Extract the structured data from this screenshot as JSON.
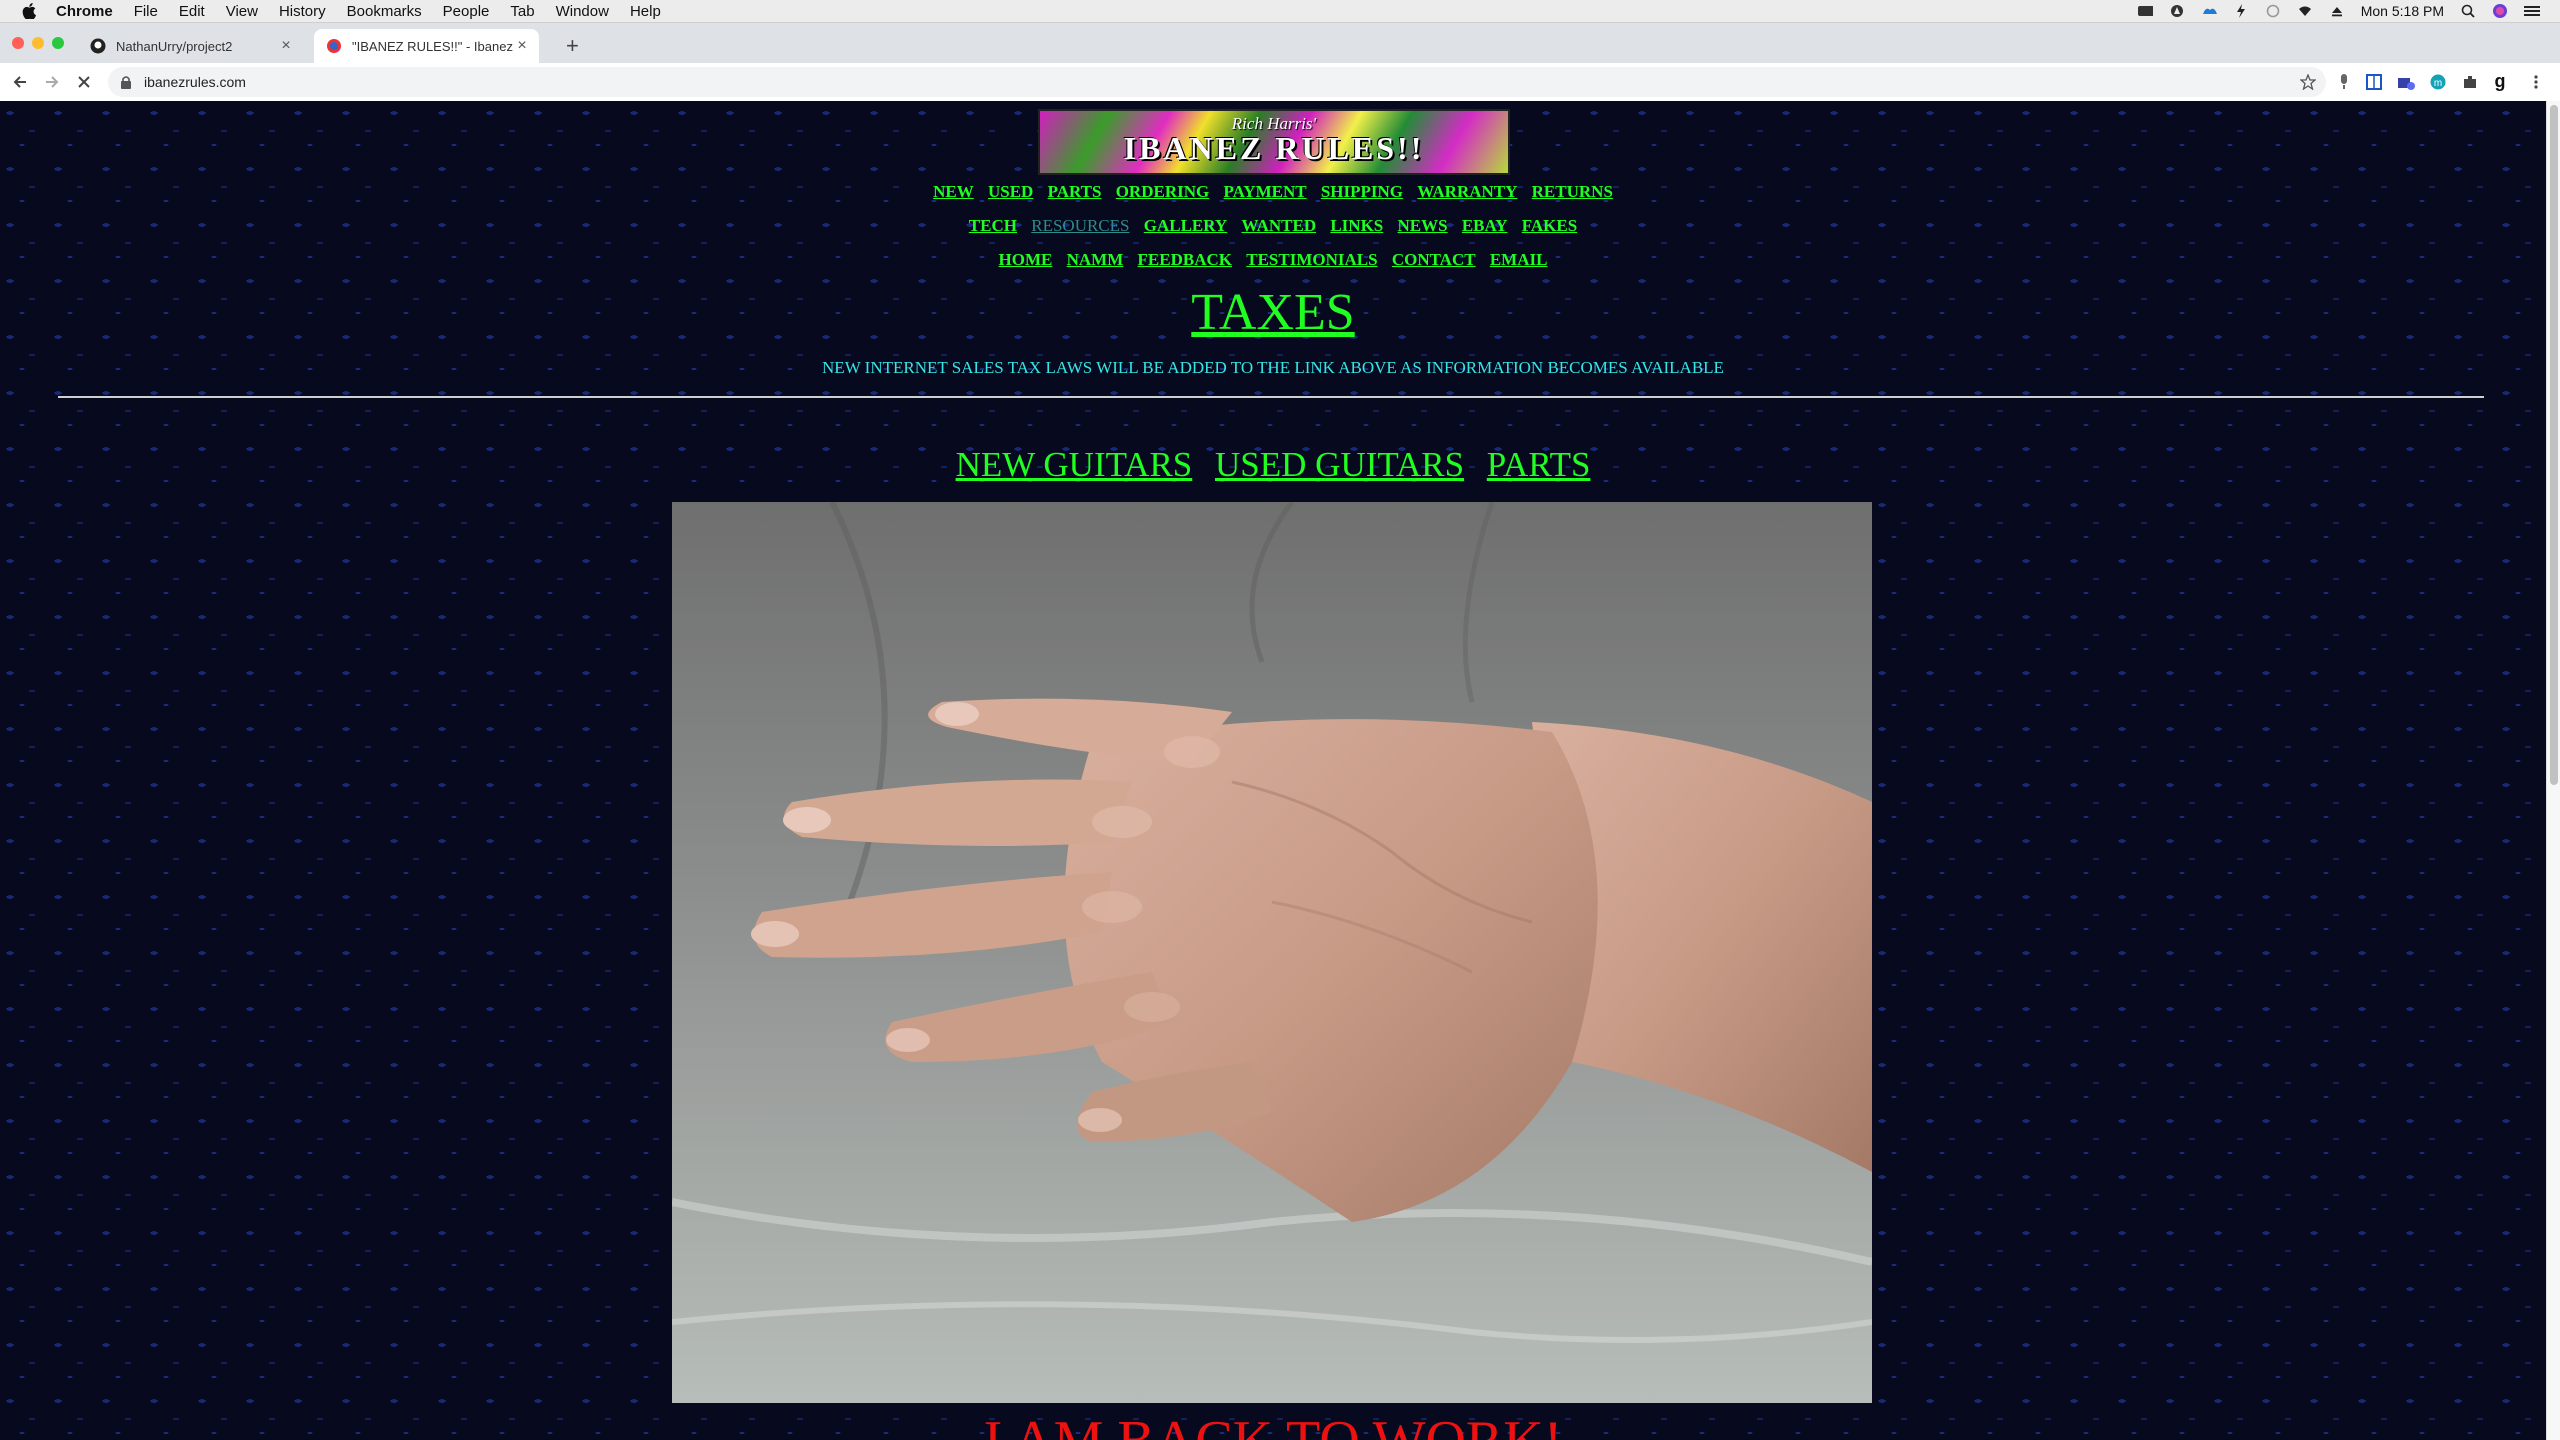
{
  "menubar": {
    "app": "Chrome",
    "items": [
      "File",
      "Edit",
      "View",
      "History",
      "Bookmarks",
      "People",
      "Tab",
      "Window",
      "Help"
    ],
    "clock": "Mon 5:18 PM"
  },
  "tabs": [
    {
      "title": "NathanUrry/project2",
      "icon": "github-icon"
    },
    {
      "title": "\"IBANEZ RULES!!\" - Ibanez Gu",
      "icon": "site-favicon"
    }
  ],
  "address": {
    "url": "ibanezrules.com"
  },
  "page": {
    "banner": {
      "sub": "Rich Harris'",
      "main": "IBANEZ RULES!!"
    },
    "nav_row1": [
      "NEW",
      "USED",
      "PARTS",
      "ORDERING",
      "PAYMENT",
      "SHIPPING",
      "WARRANTY",
      "RETURNS"
    ],
    "nav_row2": [
      "TECH",
      "RESOURCES",
      "GALLERY",
      "WANTED",
      "LINKS",
      "NEWS",
      "EBAY",
      "FAKES"
    ],
    "nav_row3": [
      "HOME",
      "NAMM",
      "FEEDBACK",
      "TESTIMONIALS",
      "CONTACT",
      "EMAIL"
    ],
    "visited_link": "RESOURCES",
    "taxes_heading": "TAXES",
    "tax_notice": "NEW INTERNET SALES TAX LAWS WILL BE ADDED TO THE LINK ABOVE AS INFORMATION BECOMES AVAILABLE",
    "big_nav": [
      "NEW GUITARS",
      "USED GUITARS",
      "PARTS"
    ],
    "back_to_work": "I AM BACK TO WORK!"
  },
  "colors": {
    "link": "#21ff21",
    "visited_link": "#2e8b8b",
    "notice": "#36e6e6",
    "alert": "#ee1111",
    "page_bg": "#070a1e"
  }
}
